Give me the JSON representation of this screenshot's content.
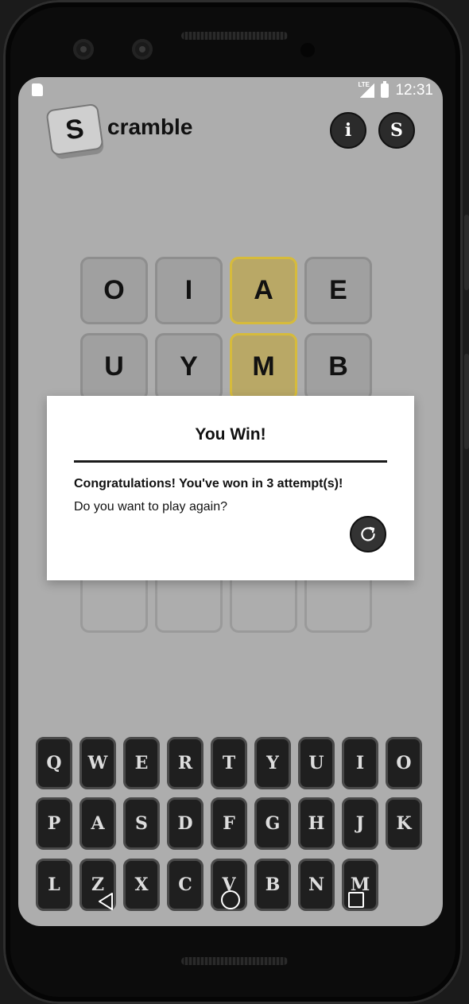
{
  "status_bar": {
    "time": "12:31",
    "network": "LTE"
  },
  "header": {
    "logo_letter": "S",
    "logo_text": "cramble",
    "info_label": "i",
    "stats_label": "S"
  },
  "grid": {
    "rows": [
      [
        {
          "letter": "O",
          "state": "absent"
        },
        {
          "letter": "I",
          "state": "absent"
        },
        {
          "letter": "A",
          "state": "present"
        },
        {
          "letter": "E",
          "state": "absent"
        }
      ],
      [
        {
          "letter": "U",
          "state": "absent"
        },
        {
          "letter": "Y",
          "state": "absent"
        },
        {
          "letter": "M",
          "state": "present"
        },
        {
          "letter": "B",
          "state": "absent"
        }
      ],
      [
        {
          "letter": "",
          "state": "empty"
        },
        {
          "letter": "",
          "state": "empty"
        },
        {
          "letter": "",
          "state": "empty"
        },
        {
          "letter": "",
          "state": "empty"
        }
      ]
    ]
  },
  "dialog": {
    "title": "You Win!",
    "message": "Congratulations! You've won in 3 attempt(s)!",
    "question": "Do you want to play again?",
    "replay_icon": "refresh-icon"
  },
  "keyboard": {
    "row1": [
      "Q",
      "W",
      "E",
      "R",
      "T",
      "Y",
      "U",
      "I",
      "O"
    ],
    "row2": [
      "P",
      "A",
      "S",
      "D",
      "F",
      "G",
      "H",
      "J",
      "K"
    ],
    "row3": [
      "L",
      "Z",
      "X",
      "C",
      "V",
      "B",
      "N",
      "M"
    ]
  },
  "nav": {
    "back_icon": "back-icon",
    "home_icon": "home-icon",
    "recents_icon": "recents-icon"
  },
  "colors": {
    "screen_bg": "#adadad",
    "present_tile": "#b9a866",
    "present_border": "#d6bb3b",
    "key_bg": "#1f1f1f"
  }
}
